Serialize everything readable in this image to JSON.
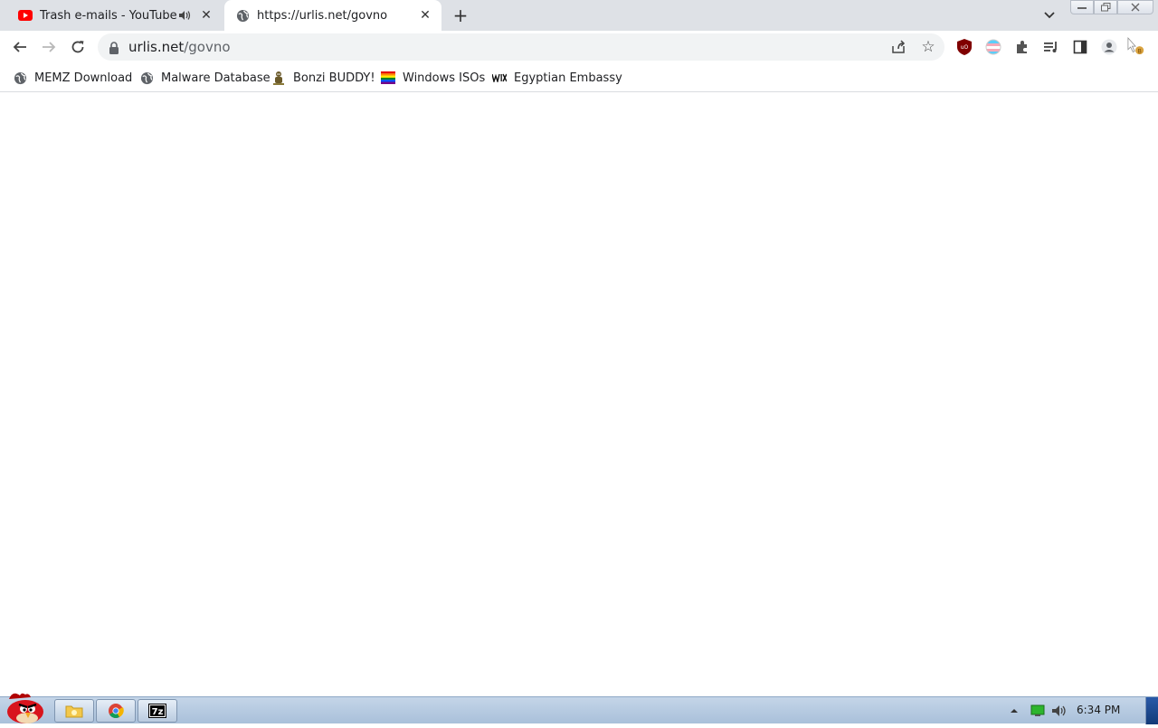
{
  "tabs": [
    {
      "title": "Trash e-mails - YouTube",
      "favicon": "youtube-icon",
      "audio": true,
      "active": false
    },
    {
      "title": "https://urlis.net/govno",
      "favicon": "globe-icon",
      "audio": false,
      "active": true
    }
  ],
  "omnibox": {
    "host": "urlis.net",
    "path": "/govno"
  },
  "bookmarks": [
    {
      "label": "MEMZ Download",
      "icon": "globe-icon"
    },
    {
      "label": "Malware Database",
      "icon": "globe-icon"
    },
    {
      "label": "Bonzi BUDDY!",
      "icon": "bonzi-icon"
    },
    {
      "label": "Windows ISOs",
      "icon": "rainbow-flag-icon"
    },
    {
      "label": "Egyptian Embassy",
      "icon": "wix-icon"
    }
  ],
  "taskbar": {
    "clock": "6:34 PM",
    "apps": [
      "file-explorer-icon",
      "chrome-icon",
      "7zip-icon"
    ]
  },
  "colors": {
    "tabstrip": "#dee1e6",
    "omnibox": "#f1f3f4",
    "taskbar": "#b9cbe0",
    "youtube_red": "#ff0000"
  }
}
